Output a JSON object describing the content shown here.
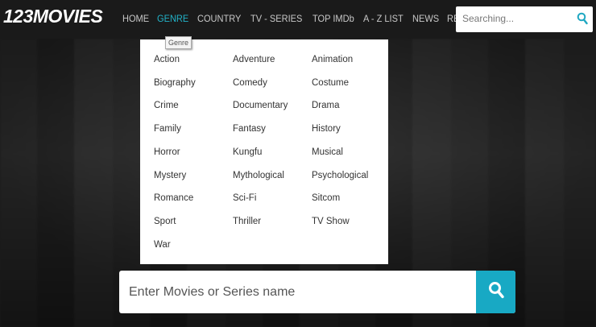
{
  "brand": {
    "logo_prefix": "123",
    "logo_suffix": "MOVIES"
  },
  "nav": {
    "items": [
      {
        "label": "HOME",
        "active": false
      },
      {
        "label": "GENRE",
        "active": true
      },
      {
        "label": "COUNTRY",
        "active": false
      },
      {
        "label": "TV - SERIES",
        "active": false
      },
      {
        "label": "TOP IMDb",
        "active": false
      },
      {
        "label": "A - Z LIST",
        "active": false
      },
      {
        "label": "NEWS",
        "active": false
      },
      {
        "label": "REQUEST",
        "active": false
      }
    ]
  },
  "top_search": {
    "placeholder": "Searching...",
    "icon": "search-icon"
  },
  "tooltip": {
    "text": "Genre"
  },
  "genres": {
    "col1": [
      "Action",
      "Biography",
      "Crime",
      "Family",
      "Horror",
      "Mystery",
      "Romance",
      "Sport",
      "War"
    ],
    "col2": [
      "Adventure",
      "Comedy",
      "Documentary",
      "Fantasy",
      "Kungfu",
      "Mythological",
      "Sci-Fi",
      "Thriller"
    ],
    "col3": [
      "Animation",
      "Costume",
      "Drama",
      "History",
      "Musical",
      "Psychological",
      "Sitcom",
      "TV Show"
    ]
  },
  "main_search": {
    "placeholder": "Enter Movies or Series name",
    "icon": "search-icon"
  },
  "colors": {
    "accent": "#20b2c8",
    "button": "#18a9c4",
    "topbar": "#1a1a1a"
  }
}
